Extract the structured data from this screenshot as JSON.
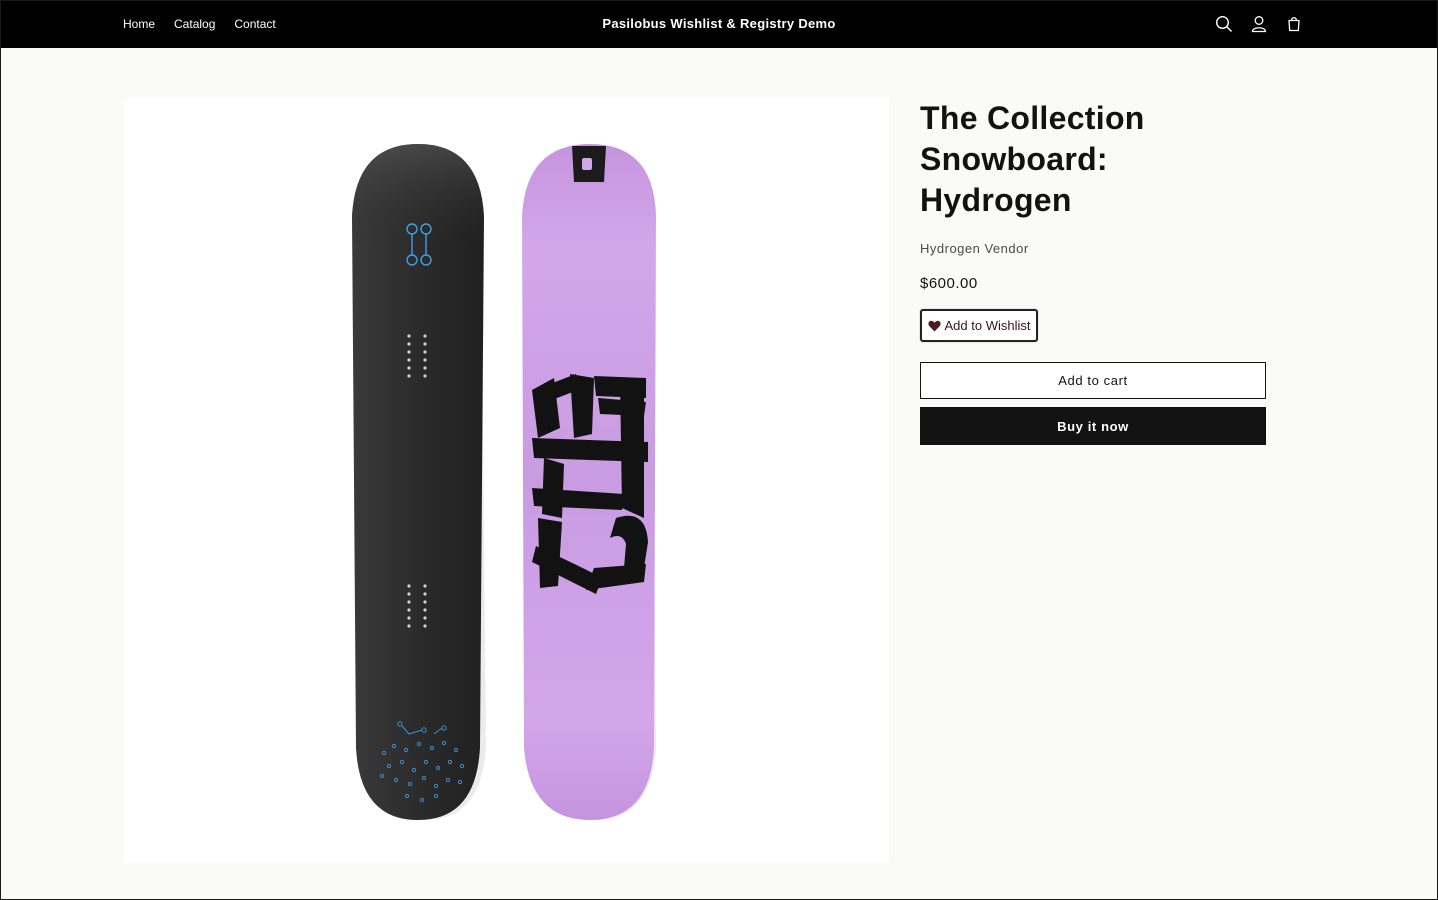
{
  "header": {
    "nav": [
      "Home",
      "Catalog",
      "Contact"
    ],
    "store_title": "Pasilobus Wishlist & Registry Demo",
    "icons": [
      "search-icon",
      "account-icon",
      "cart-icon"
    ],
    "background": "#000000"
  },
  "product": {
    "title": "The Collection Snowboard: Hydrogen",
    "vendor": "Hydrogen Vendor",
    "price": "$600.00",
    "wishlist_label": "Add to Wishlist",
    "add_to_cart_label": "Add to cart",
    "buy_now_label": "Buy it now",
    "image": {
      "board_colors": {
        "base": "#2b2b2b",
        "top": "#c89be0"
      },
      "board_graphic": "H2"
    }
  },
  "colors": {
    "accent": "#121212",
    "wishlist_heart": "#4a1a1d",
    "page_bg": "#fafaf8"
  }
}
